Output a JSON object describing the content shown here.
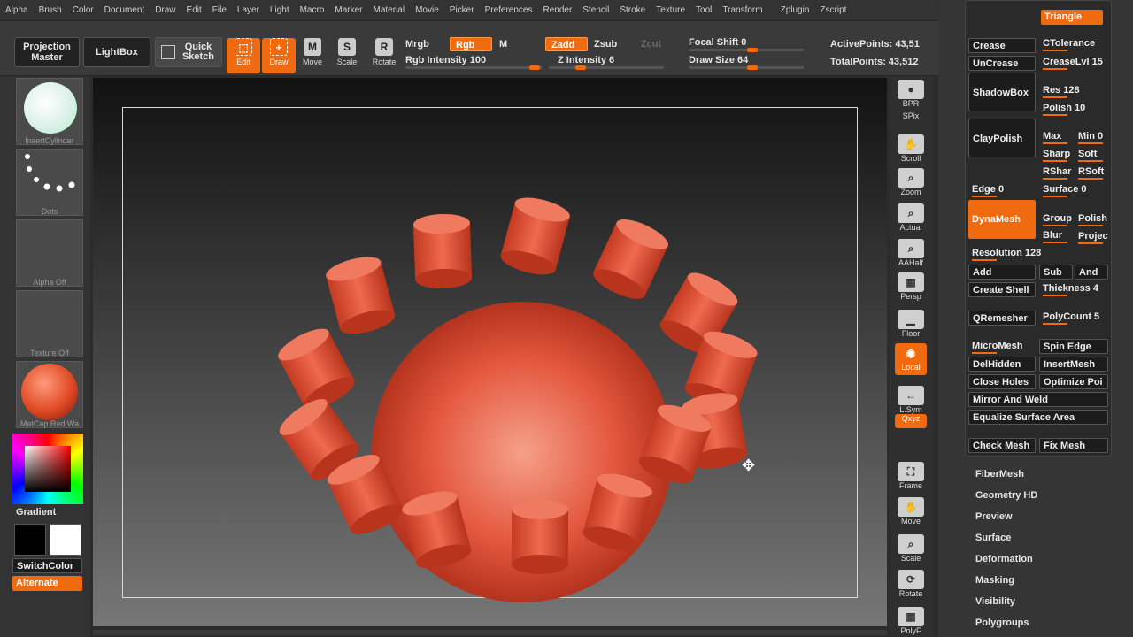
{
  "menu": [
    "Alpha",
    "Brush",
    "Color",
    "Document",
    "Draw",
    "Edit",
    "File",
    "Layer",
    "Light",
    "Macro",
    "Marker",
    "Material",
    "Movie",
    "Picker",
    "Preferences",
    "Render",
    "Stencil",
    "Stroke",
    "Texture",
    "Tool",
    "Transform",
    "Zplugin",
    "Zscript"
  ],
  "toolbar": {
    "projection_master": "Projection Master",
    "lightbox": "LightBox",
    "quick_sketch": "Quick Sketch",
    "edit": "Edit",
    "draw": "Draw",
    "move": "Move",
    "scale": "Scale",
    "rotate": "Rotate",
    "mrgb": "Mrgb",
    "rgb": "Rgb",
    "m": "M",
    "zadd": "Zadd",
    "zsub": "Zsub",
    "zcut": "Zcut",
    "rgb_intensity": "Rgb  Intensity 100",
    "z_intensity": "Z  Intensity 6",
    "focal_shift": "Focal  Shift 0",
    "draw_size": "Draw  Size 64",
    "active_points": "ActivePoints: 43,51",
    "total_points": "TotalPoints: 43,512"
  },
  "left": {
    "brush": "InsertCylinder",
    "stroke": "Dots",
    "alpha": "Alpha  Off",
    "texture": "Texture  Off",
    "material": "MatCap  Red  Wa",
    "gradient": "Gradient",
    "switch_color": "SwitchColor",
    "alternate": "Alternate"
  },
  "shelf": [
    "BPR",
    "SPix",
    "Scroll",
    "Zoom",
    "Actual",
    "AAHalf",
    "Persp",
    "Floor",
    "Local",
    "L.Sym",
    "Qxyz",
    "Frame",
    "Move",
    "Scale",
    "Rotate",
    "PolyF"
  ],
  "geometry": {
    "triangle": "Triangle",
    "crease": "Crease",
    "ctolerance": "CTolerance",
    "uncrease": "UnCrease",
    "creaselvl": "CreaseLvl 15",
    "shadowbox": "ShadowBox",
    "res": "Res 128",
    "polish": "Polish 10",
    "claypolish": "ClayPolish",
    "max": "Max",
    "min": "Min 0",
    "sharp": "Sharp",
    "soft": "Soft",
    "rsharp": "RShar",
    "rsoft": "RSoft",
    "edge": "Edge 0",
    "surface": "Surface 0",
    "dynamesh": "DynaMesh",
    "group": "Group",
    "polish2": "Polish",
    "blur": "Blur",
    "project": "Projec",
    "resolution": "Resolution 128",
    "add": "Add",
    "sub": "Sub",
    "and": "And",
    "create_shell": "Create Shell",
    "thickness": "Thickness 4",
    "qremesher": "QRemesher",
    "polycount": "PolyCount 5",
    "micromesh": "MicroMesh",
    "spin_edge": "Spin Edge",
    "delhidden": "DelHidden",
    "insertmesh": "InsertMesh",
    "close_holes": "Close Holes",
    "optimize": "Optimize Poi",
    "mirror_weld": "Mirror And Weld",
    "equalize": "Equalize Surface Area",
    "check_mesh": "Check Mesh",
    "fix_mesh": "Fix Mesh"
  },
  "subpalettes": [
    "FiberMesh",
    "Geometry HD",
    "Preview",
    "Surface",
    "Deformation",
    "Masking",
    "Visibility",
    "Polygroups"
  ],
  "colors": {
    "accent": "#f06a10",
    "model": "#e5604a"
  }
}
